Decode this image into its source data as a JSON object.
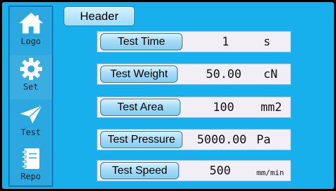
{
  "sidebar": {
    "items": [
      {
        "label": "Logo",
        "icon": "home-icon"
      },
      {
        "label": "Set",
        "icon": "gear-icon"
      },
      {
        "label": "Test",
        "icon": "paper-plane-icon"
      },
      {
        "label": "Repo",
        "icon": "notebook-icon"
      }
    ]
  },
  "header": {
    "title": "Header"
  },
  "params": [
    {
      "label": "Test Time",
      "value": "1",
      "unit": "s"
    },
    {
      "label": "Test Weight",
      "value": "50.00",
      "unit": "cN"
    },
    {
      "label": "Test Area",
      "value": "100",
      "unit": "mm2"
    },
    {
      "label": "Test Pressure",
      "value": "5000.00",
      "unit": "Pa"
    },
    {
      "label": "Test Speed",
      "value": "500",
      "unit": "mm/min"
    }
  ],
  "colors": {
    "background": "#17b0ec",
    "sidebar": "#2aa8df",
    "row_field": "#f1eef6",
    "button_top": "#d9f3fe",
    "button_bottom": "#86cdef"
  }
}
